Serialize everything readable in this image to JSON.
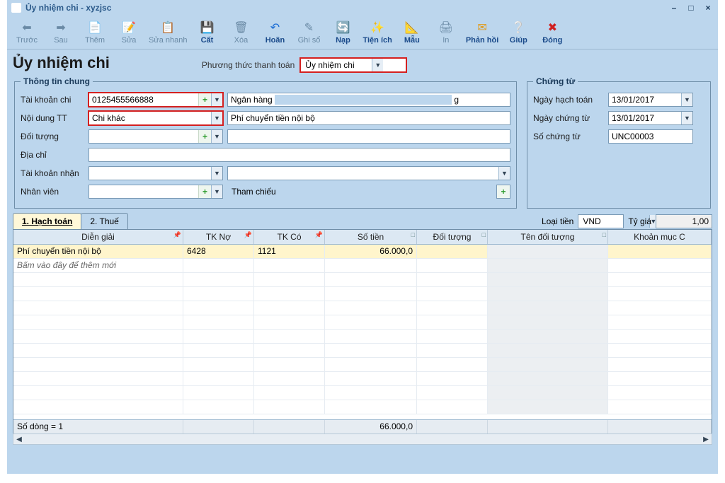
{
  "window": {
    "title": "Ủy nhiệm chi - xyzjsc"
  },
  "toolbar": {
    "before": "Trước",
    "after": "Sau",
    "add": "Thêm",
    "edit": "Sửa",
    "quick_edit": "Sửa nhanh",
    "cut": "Cất",
    "delete": "Xóa",
    "undo": "Hoãn",
    "post": "Ghi sổ",
    "load": "Nạp",
    "util": "Tiện ích",
    "template": "Mẫu",
    "print": "In",
    "feedback": "Phản hồi",
    "help": "Giúp",
    "close": "Đóng"
  },
  "header": {
    "title": "Ủy nhiệm chi",
    "pay_method_label": "Phương thức thanh toán",
    "pay_method_value": "Ủy nhiệm chi"
  },
  "info": {
    "legend": "Thông tin chung",
    "account_label": "Tài khoản chi",
    "account_value": "0125455566888",
    "bank_label": "Ngân hàng",
    "bank_value": "",
    "content_label": "Nội dung TT",
    "content_value": "Chi khác",
    "content_note": "Phí chuyển tiền nội bộ",
    "object_label": "Đối tượng",
    "object_value": "",
    "object_name": "",
    "address_label": "Địa chỉ",
    "address_value": "",
    "recv_account_label": "Tài khoản nhận",
    "recv_account_value": "",
    "recv_bank": "",
    "staff_label": "Nhân viên",
    "staff_value": "",
    "ref_label": "Tham chiếu"
  },
  "voucher": {
    "legend": "Chứng từ",
    "acct_date_label": "Ngày hạch toán",
    "acct_date_value": "13/01/2017",
    "doc_date_label": "Ngày chứng từ",
    "doc_date_value": "13/01/2017",
    "doc_no_label": "Số chứng từ",
    "doc_no_value": "UNC00003"
  },
  "tabs": {
    "t1": "1. Hạch toán",
    "t2": "2. Thuế"
  },
  "currency": {
    "label": "Loại tiền",
    "value": "VND",
    "rate_label": "Tỷ giá",
    "rate_value": "1,00"
  },
  "grid": {
    "cols": {
      "expl": "Diễn giải",
      "debit": "TK Nợ",
      "credit": "TK Có",
      "amt": "Số tiền",
      "obj": "Đối tượng",
      "objn": "Tên đối tượng",
      "cost": "Khoản mục C"
    },
    "rows": [
      {
        "expl": "Phí chuyển tiền nội bộ",
        "debit": "6428",
        "credit": "1121",
        "amt": "66.000,0",
        "obj": "",
        "objn": "",
        "cost": ""
      }
    ],
    "new_row_hint": "Bấm vào đây để thêm mới",
    "footer_rows": "Số dòng = 1",
    "footer_total": "66.000,0"
  }
}
